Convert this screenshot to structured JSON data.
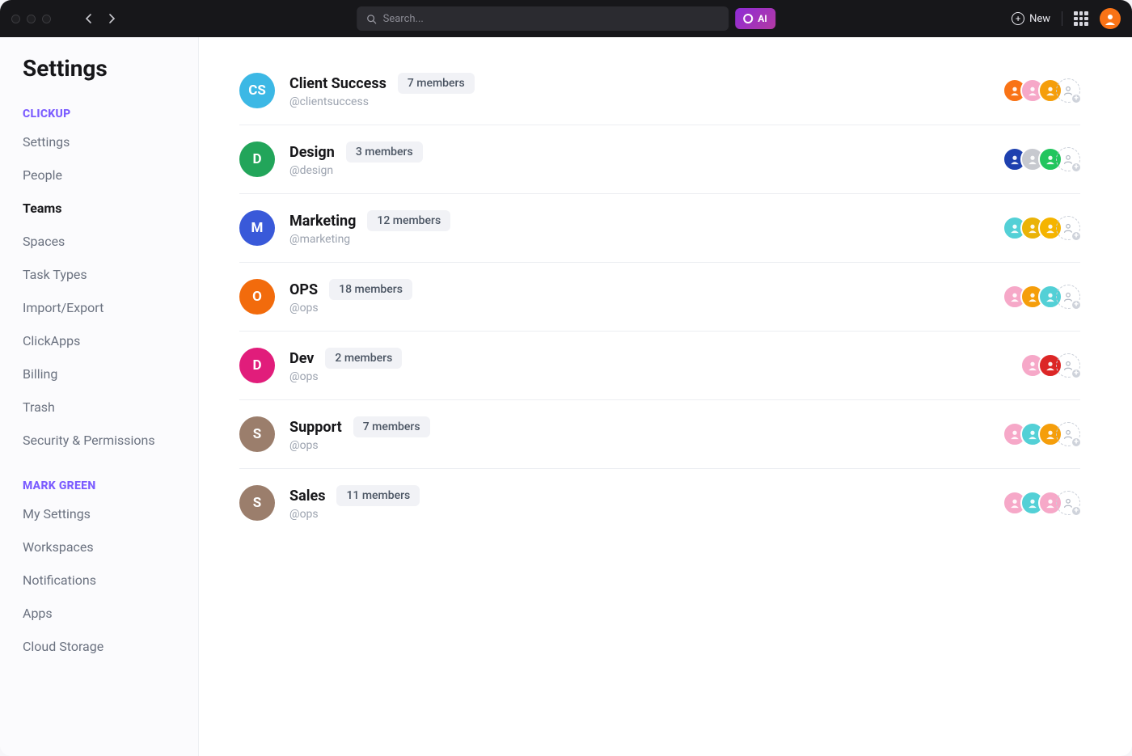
{
  "topbar": {
    "search_placeholder": "Search...",
    "ai_label": "AI",
    "new_label": "New"
  },
  "page": {
    "title": "Settings"
  },
  "sidebar": {
    "group1_label": "CLICKUP",
    "group1_items": [
      {
        "label": "Settings",
        "active": false
      },
      {
        "label": "People",
        "active": false
      },
      {
        "label": "Teams",
        "active": true
      },
      {
        "label": "Spaces",
        "active": false
      },
      {
        "label": "Task Types",
        "active": false
      },
      {
        "label": "Import/Export",
        "active": false
      },
      {
        "label": "ClickApps",
        "active": false
      },
      {
        "label": "Billing",
        "active": false
      },
      {
        "label": "Trash",
        "active": false
      },
      {
        "label": "Security & Permissions",
        "active": false
      }
    ],
    "group2_label": "MARK GREEN",
    "group2_items": [
      {
        "label": "My Settings"
      },
      {
        "label": "Workspaces"
      },
      {
        "label": "Notifications"
      },
      {
        "label": "Apps"
      },
      {
        "label": "Cloud Storage"
      }
    ]
  },
  "teams": [
    {
      "initials": "CS",
      "color": "#3cb8e5",
      "name": "Client Success",
      "handle": "@clientsuccess",
      "members": "7 members",
      "avatars": [
        "#f97316",
        "#f6a8c8",
        "#f59e0b"
      ]
    },
    {
      "initials": "D",
      "color": "#22a55a",
      "name": "Design",
      "handle": "@design",
      "members": "3 members",
      "avatars": [
        "#1e40af",
        "#c7c9cf",
        "#22c55e"
      ]
    },
    {
      "initials": "M",
      "color": "#3959d9",
      "name": "Marketing",
      "handle": "@marketing",
      "members": "12 members",
      "avatars": [
        "#53d0d6",
        "#eab308",
        "#f5b400"
      ]
    },
    {
      "initials": "O",
      "color": "#f26b0c",
      "name": "OPS",
      "handle": "@ops",
      "members": "18 members",
      "avatars": [
        "#f6a8c8",
        "#f59e0b",
        "#53d0d6"
      ]
    },
    {
      "initials": "D",
      "color": "#e11d7b",
      "name": "Dev",
      "handle": "@ops",
      "members": "2 members",
      "avatars": [
        "#f6a8c8",
        "#dc2626"
      ]
    },
    {
      "initials": "S",
      "color": "#9b7e6c",
      "name": "Support",
      "handle": "@ops",
      "members": "7 members",
      "avatars": [
        "#f6a8c8",
        "#53d0d6",
        "#f59e0b"
      ]
    },
    {
      "initials": "S",
      "color": "#9b7e6c",
      "name": "Sales",
      "handle": "@ops",
      "members": "11 members",
      "avatars": [
        "#f6a8c8",
        "#53d0d6",
        "#f6a8c8"
      ]
    }
  ]
}
